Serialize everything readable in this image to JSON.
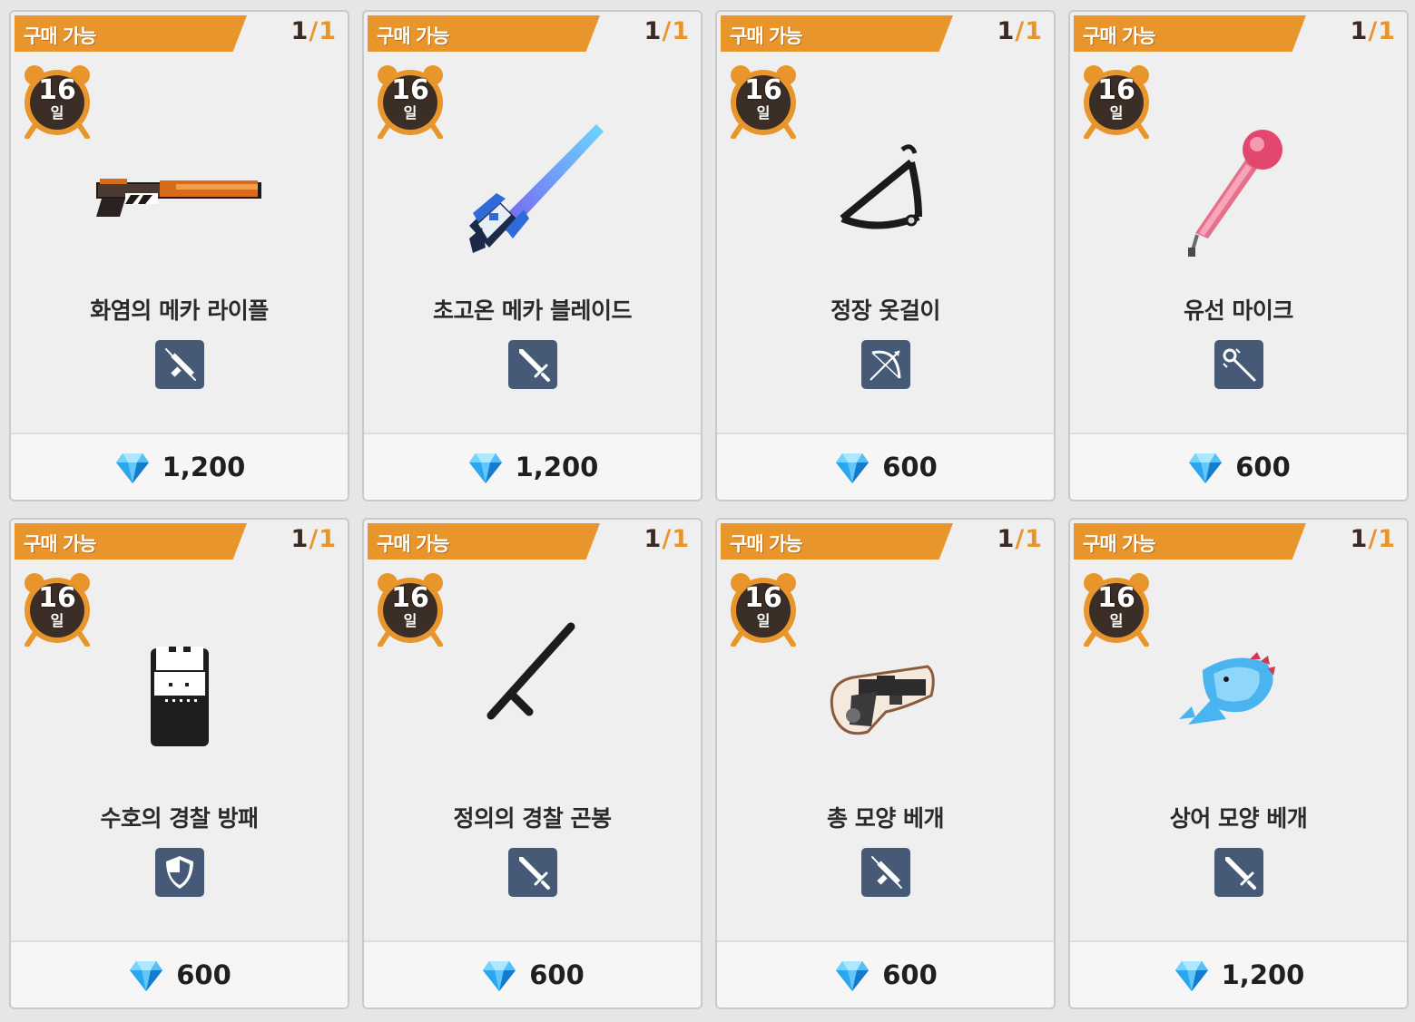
{
  "shop": {
    "colors": {
      "banner": "#e8962c",
      "badge_dark": "#3b2e26",
      "type_icon_bg": "#465a78",
      "gem": "#2aa7ee"
    },
    "items": [
      {
        "status": "구매 가능",
        "stock_current": "1",
        "stock_separator": "/",
        "stock_max": "1",
        "days": "16",
        "days_unit": "일",
        "name": "화염의 메카 라이플",
        "type_icon": "rifle-icon",
        "image": "flame-mecha-rifle",
        "price": "1,200",
        "currency_icon": "diamond-gem-icon"
      },
      {
        "status": "구매 가능",
        "stock_current": "1",
        "stock_separator": "/",
        "stock_max": "1",
        "days": "16",
        "days_unit": "일",
        "name": "초고온 메카 블레이드",
        "type_icon": "sword-icon",
        "image": "mecha-blade",
        "price": "1,200",
        "currency_icon": "diamond-gem-icon"
      },
      {
        "status": "구매 가능",
        "stock_current": "1",
        "stock_separator": "/",
        "stock_max": "1",
        "days": "16",
        "days_unit": "일",
        "name": "정장 옷걸이",
        "type_icon": "bow-icon",
        "image": "suit-hanger",
        "price": "600",
        "currency_icon": "diamond-gem-icon"
      },
      {
        "status": "구매 가능",
        "stock_current": "1",
        "stock_separator": "/",
        "stock_max": "1",
        "days": "16",
        "days_unit": "일",
        "name": "유선 마이크",
        "type_icon": "staff-icon",
        "image": "wired-microphone",
        "price": "600",
        "currency_icon": "diamond-gem-icon"
      },
      {
        "status": "구매 가능",
        "stock_current": "1",
        "stock_separator": "/",
        "stock_max": "1",
        "days": "16",
        "days_unit": "일",
        "name": "수호의 경찰 방패",
        "type_icon": "shield-icon",
        "image": "police-shield",
        "price": "600",
        "currency_icon": "diamond-gem-icon"
      },
      {
        "status": "구매 가능",
        "stock_current": "1",
        "stock_separator": "/",
        "stock_max": "1",
        "days": "16",
        "days_unit": "일",
        "name": "정의의 경찰 곤봉",
        "type_icon": "sword-icon",
        "image": "police-baton",
        "price": "600",
        "currency_icon": "diamond-gem-icon"
      },
      {
        "status": "구매 가능",
        "stock_current": "1",
        "stock_separator": "/",
        "stock_max": "1",
        "days": "16",
        "days_unit": "일",
        "name": "총 모양 베개",
        "type_icon": "rifle-icon",
        "image": "gun-pillow",
        "price": "600",
        "currency_icon": "diamond-gem-icon"
      },
      {
        "status": "구매 가능",
        "stock_current": "1",
        "stock_separator": "/",
        "stock_max": "1",
        "days": "16",
        "days_unit": "일",
        "name": "상어 모양 베개",
        "type_icon": "sword-icon",
        "image": "shark-pillow",
        "price": "1,200",
        "currency_icon": "diamond-gem-icon"
      }
    ]
  }
}
